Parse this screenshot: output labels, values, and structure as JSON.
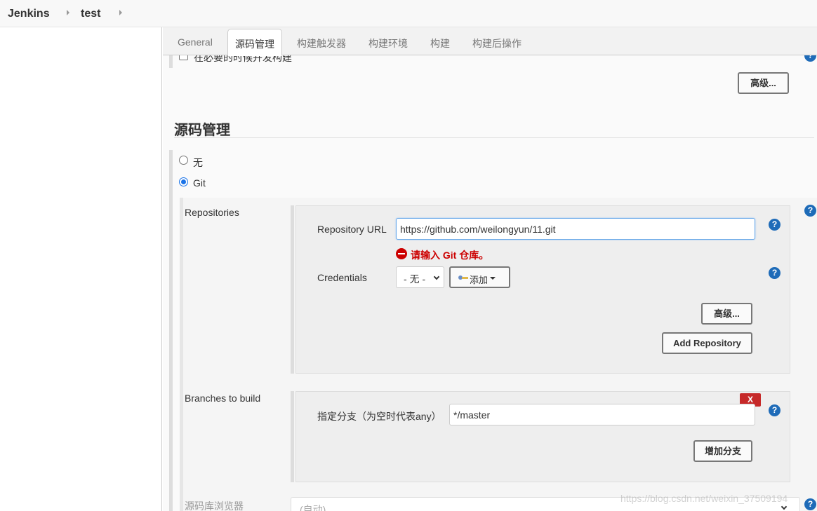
{
  "breadcrumb": {
    "items": [
      "Jenkins",
      "test"
    ]
  },
  "tabs": [
    "General",
    "源码管理",
    "构建触发器",
    "构建环境",
    "构建",
    "构建后操作"
  ],
  "active_tab": "源码管理",
  "upper": {
    "checkbox_label": "在必要的时候并发构建",
    "advanced_button": "高级..."
  },
  "scm": {
    "title": "源码管理",
    "options": [
      "无",
      "Git"
    ],
    "selected": "Git",
    "repositories": {
      "label": "Repositories",
      "url_label": "Repository URL",
      "url_value": "https://github.com/weilongyun/11.git",
      "error": "请输入 Git 仓库。",
      "credentials_label": "Credentials",
      "credentials_value": "- 无 -",
      "add_button": "添加",
      "advanced_button": "高级...",
      "add_repository_button": "Add Repository"
    },
    "branches": {
      "label": "Branches to build",
      "branch_label": "指定分支（为空时代表any）",
      "branch_value": "*/master",
      "delete_button": "X",
      "add_branch_button": "增加分支"
    },
    "browser": {
      "label": "源码库浏览器",
      "value": "(自动)"
    }
  },
  "help_symbol": "?",
  "watermark": "https://blog.csdn.net/weixin_37509194",
  "colors": {
    "error": "#cc0000",
    "help": "#1e6bb8",
    "delete": "#c62828",
    "focus": "#6aa9e9"
  }
}
